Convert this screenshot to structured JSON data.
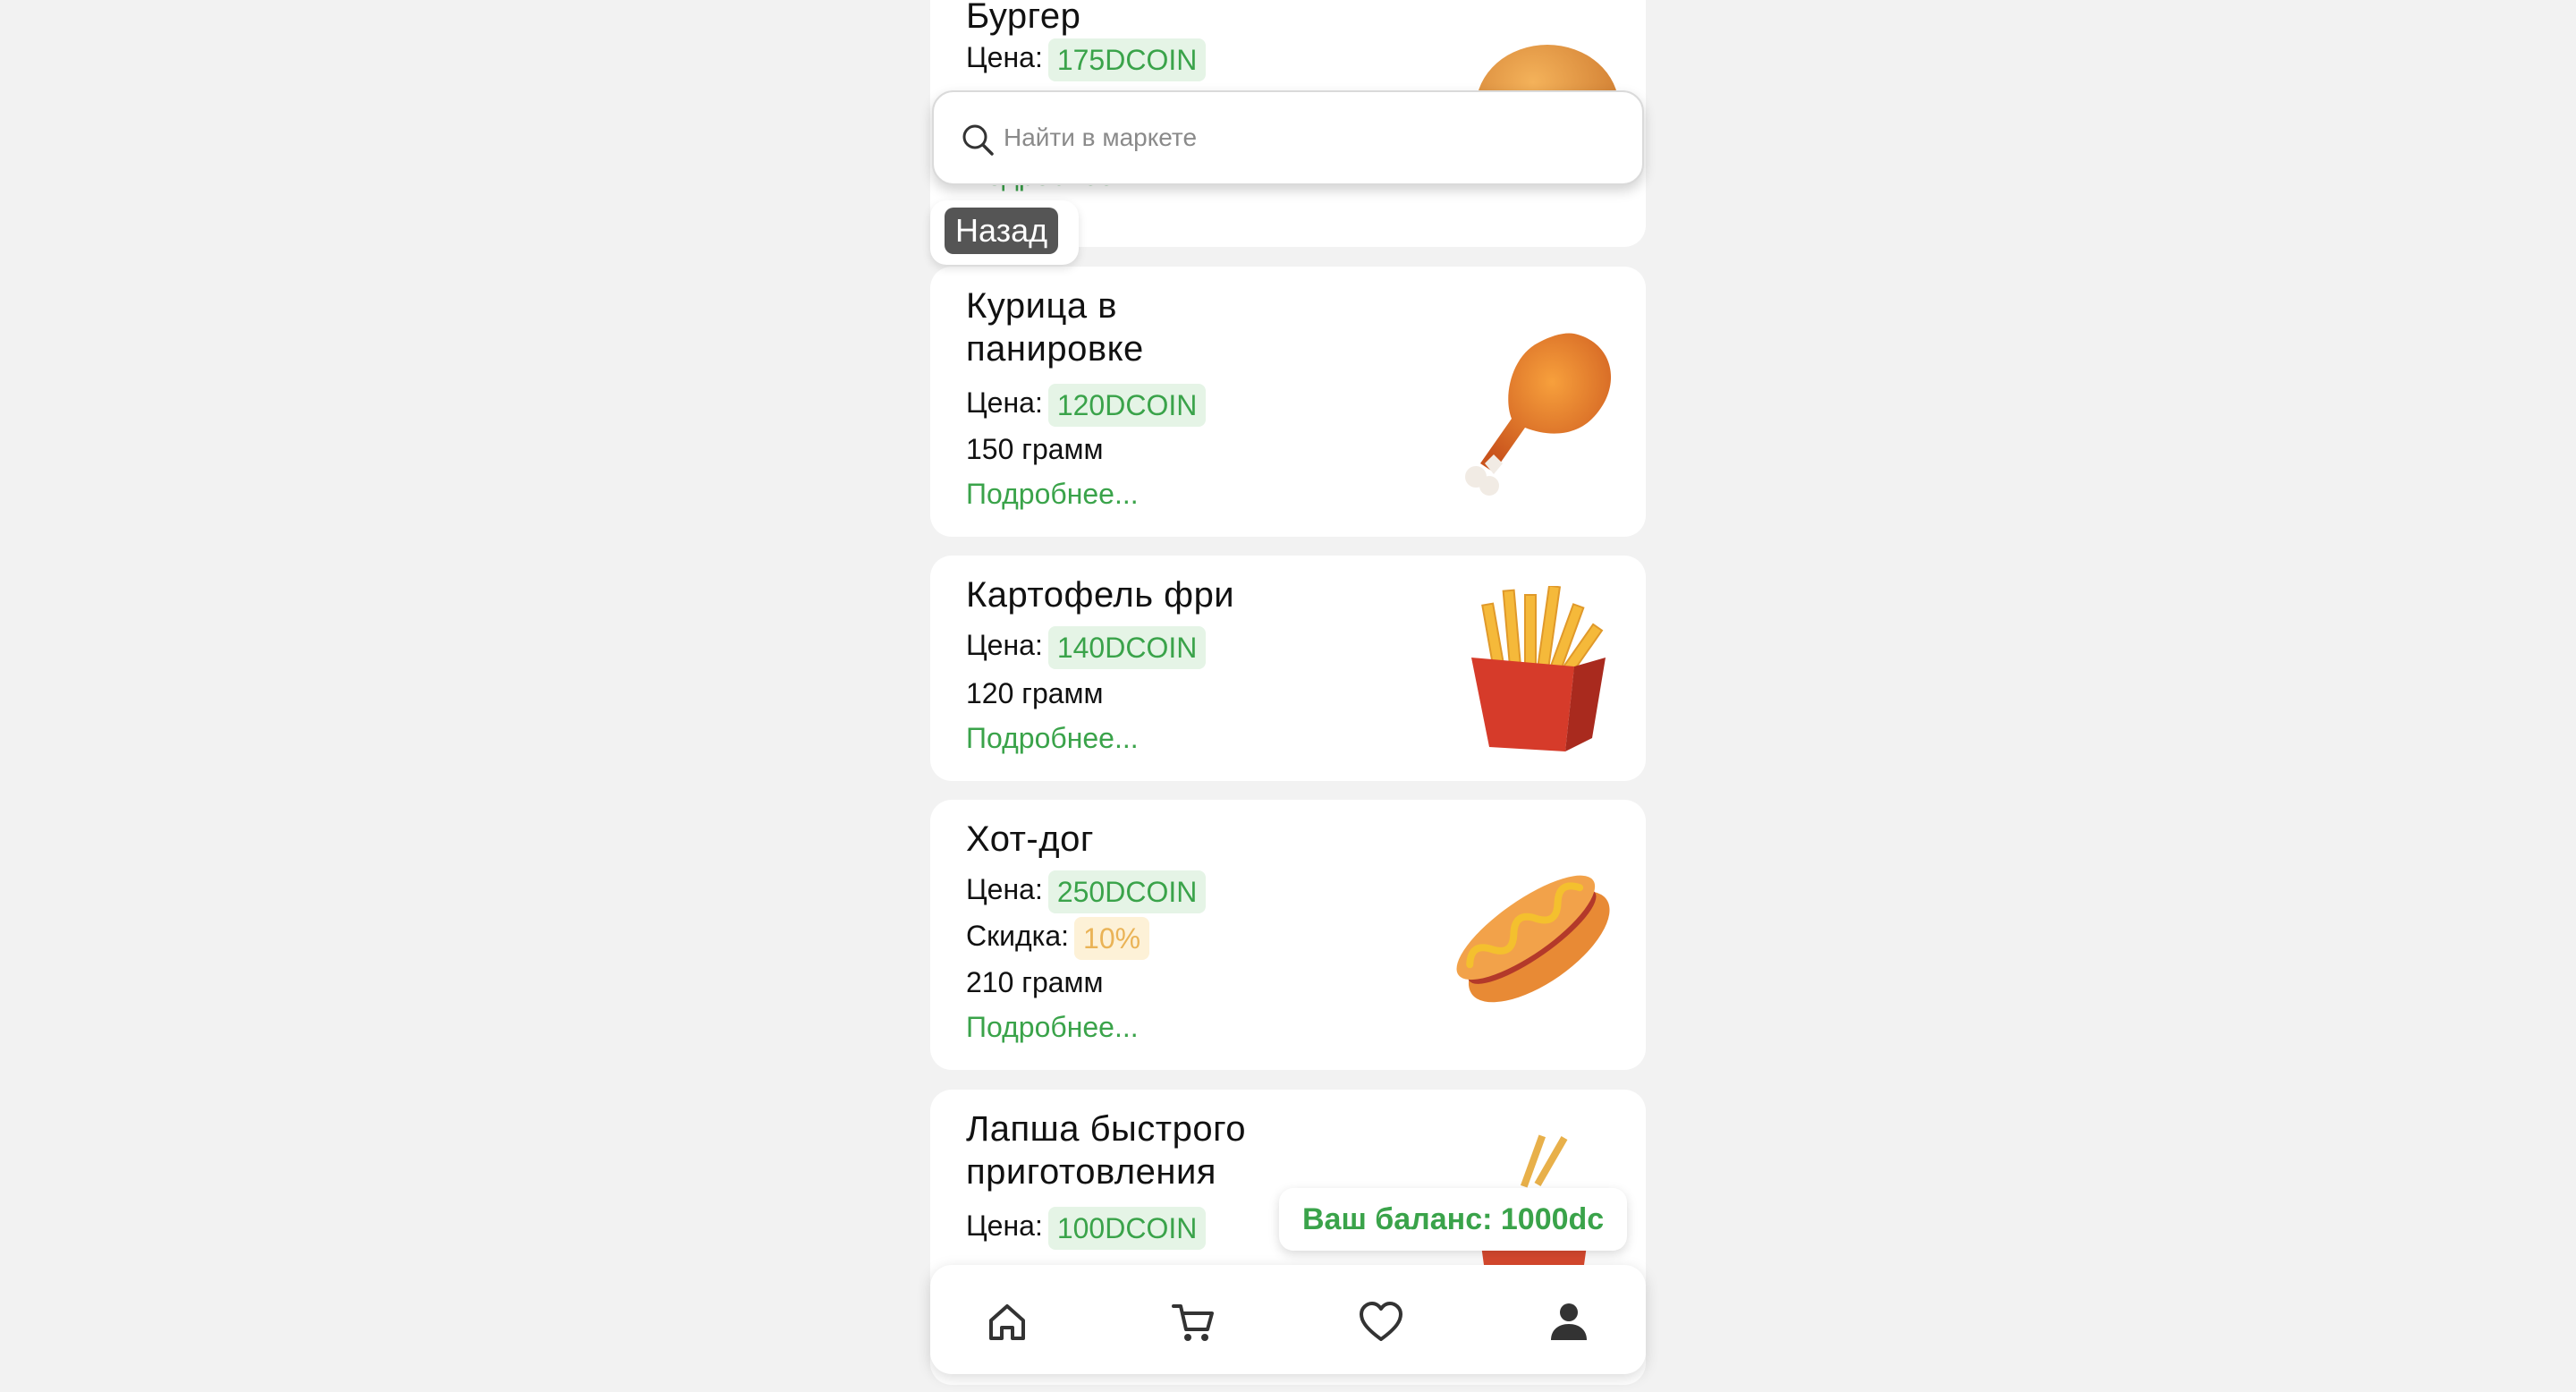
{
  "search": {
    "placeholder": "Найти в маркете"
  },
  "back_label": "Назад",
  "balance_label": "Ваш баланс: 1000dc",
  "price_label": "Цена:",
  "discount_label": "Скидка:",
  "more_label": "Подробнее...",
  "products": [
    {
      "name": "Бургер",
      "price": "175DCOIN",
      "image": "burger"
    },
    {
      "name_line1": "Курица в",
      "name_line2": "панировке",
      "price": "120DCOIN",
      "weight": "150 грамм",
      "image": "fried-chicken-leg"
    },
    {
      "name": "Картофель фри",
      "price": "140DCOIN",
      "weight": "120 грамм",
      "image": "french-fries"
    },
    {
      "name": "Хот-дог",
      "price": "250DCOIN",
      "discount": "10%",
      "weight": "210 грамм",
      "image": "hot-dog"
    },
    {
      "name_line1": "Лапша быстрого",
      "name_line2": "приготовления",
      "price": "100DCOIN",
      "image": "instant-noodles"
    }
  ],
  "nav": [
    "home-icon",
    "cart-icon",
    "heart-icon",
    "user-icon"
  ],
  "colors": {
    "accent": "#3aa34a",
    "discount": "#eab356",
    "background": "#f2f2f2"
  }
}
